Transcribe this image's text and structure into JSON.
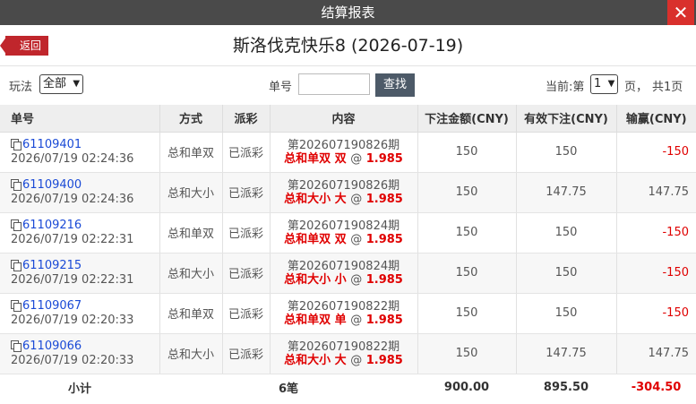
{
  "window": {
    "title": "结算报表",
    "close": "✕"
  },
  "header": {
    "back_label": "返回",
    "title": "斯洛伐克快乐8 (2026-07-19)"
  },
  "toolbar": {
    "play_label": "玩法",
    "play_value": "全部",
    "order_label": "单号",
    "order_value": "",
    "search_label": "查找",
    "current_label": "当前:第",
    "page_value": "1",
    "page_suffix": "页，",
    "total_pages": "共1页"
  },
  "table": {
    "headers": [
      "单号",
      "方式",
      "派彩",
      "内容",
      "下注金额(CNY)",
      "有效下注(CNY)",
      "输赢(CNY)"
    ],
    "rows": [
      {
        "order": "61109401",
        "time": "2026/07/19 02:24:36",
        "method": "总和单双",
        "status": "已派彩",
        "period": "第202607190826期",
        "bet": "总和单双 双",
        "odds": "1.985",
        "amount": "150",
        "valid": "150",
        "win": "-150"
      },
      {
        "order": "61109400",
        "time": "2026/07/19 02:24:36",
        "method": "总和大小",
        "status": "已派彩",
        "period": "第202607190826期",
        "bet": "总和大小 大",
        "odds": "1.985",
        "amount": "150",
        "valid": "147.75",
        "win": "147.75"
      },
      {
        "order": "61109216",
        "time": "2026/07/19 02:22:31",
        "method": "总和单双",
        "status": "已派彩",
        "period": "第202607190824期",
        "bet": "总和单双 双",
        "odds": "1.985",
        "amount": "150",
        "valid": "150",
        "win": "-150"
      },
      {
        "order": "61109215",
        "time": "2026/07/19 02:22:31",
        "method": "总和大小",
        "status": "已派彩",
        "period": "第202607190824期",
        "bet": "总和大小 小",
        "odds": "1.985",
        "amount": "150",
        "valid": "150",
        "win": "-150"
      },
      {
        "order": "61109067",
        "time": "2026/07/19 02:20:33",
        "method": "总和单双",
        "status": "已派彩",
        "period": "第202607190822期",
        "bet": "总和单双 单",
        "odds": "1.985",
        "amount": "150",
        "valid": "150",
        "win": "-150"
      },
      {
        "order": "61109066",
        "time": "2026/07/19 02:20:33",
        "method": "总和大小",
        "status": "已派彩",
        "period": "第202607190822期",
        "bet": "总和大小 大",
        "odds": "1.985",
        "amount": "150",
        "valid": "147.75",
        "win": "147.75"
      }
    ],
    "summary": {
      "label": "小计",
      "count": "6笔",
      "amount": "900.00",
      "valid": "895.50",
      "win": "-304.50"
    }
  },
  "colors": {
    "accent_red": "#c0262c",
    "loss_red": "#e00000",
    "link_blue": "#1a4ad6",
    "titlebar": "#4a4a4a"
  }
}
